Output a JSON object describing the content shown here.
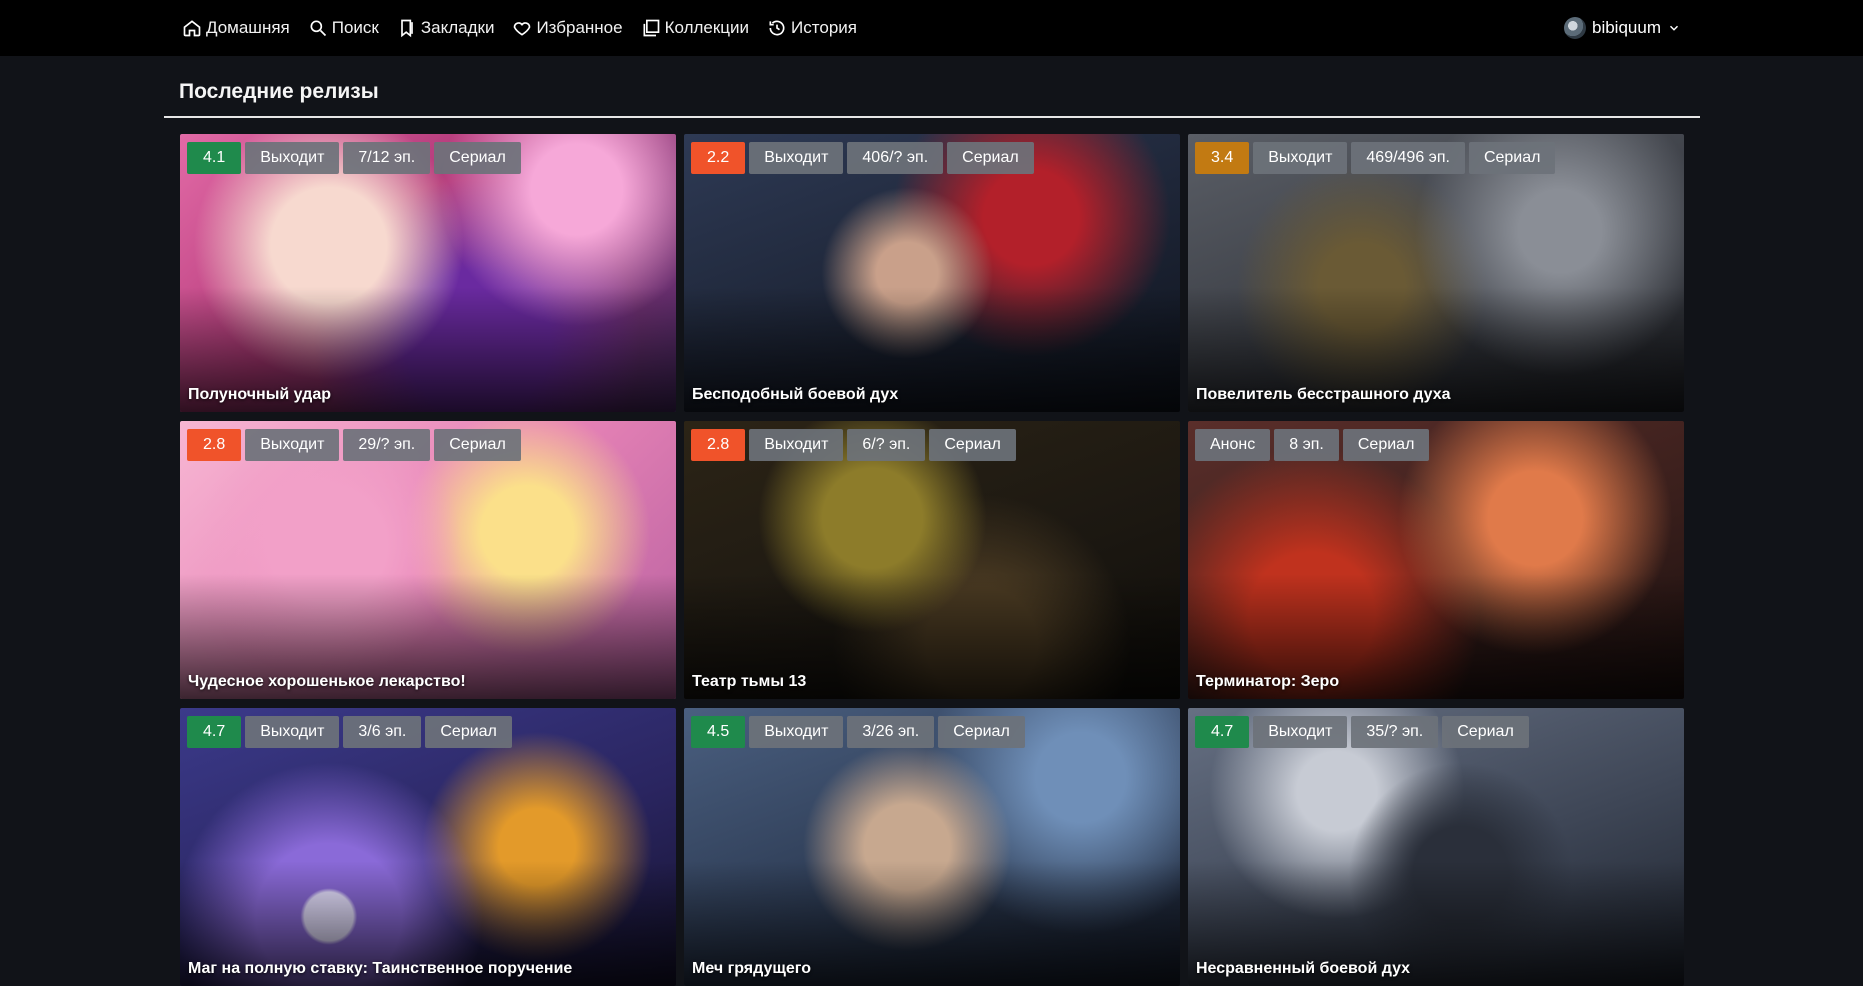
{
  "nav": {
    "items": [
      {
        "label": "Домашняя",
        "icon": "home-icon"
      },
      {
        "label": "Поиск",
        "icon": "search-icon"
      },
      {
        "label": "Закладки",
        "icon": "bookmark-icon"
      },
      {
        "label": "Избранное",
        "icon": "heart-icon"
      },
      {
        "label": "Коллекции",
        "icon": "collection-icon"
      },
      {
        "label": "История",
        "icon": "history-icon"
      }
    ],
    "username": "bibiquum"
  },
  "section": {
    "title": "Последние релизы"
  },
  "colors": {
    "rating_green": "#1f8a4c",
    "rating_orange": "#f0532a",
    "rating_amber": "#c27a12",
    "badge_gray": "#6c727a"
  },
  "cards": [
    {
      "title": "Полуночный удар",
      "rating": "4.1",
      "rating_color": "#1f8a4c",
      "badges": [
        "Выходит",
        "7/12 эп.",
        "Сериал"
      ]
    },
    {
      "title": "Бесподобный боевой дух",
      "rating": "2.2",
      "rating_color": "#f0532a",
      "badges": [
        "Выходит",
        "406/? эп.",
        "Сериал"
      ]
    },
    {
      "title": "Повелитель бесстрашного духа",
      "rating": "3.4",
      "rating_color": "#c27a12",
      "badges": [
        "Выходит",
        "469/496 эп.",
        "Сериал"
      ]
    },
    {
      "title": "Чудесное хорошенькое лекарство!",
      "rating": "2.8",
      "rating_color": "#f0532a",
      "badges": [
        "Выходит",
        "29/? эп.",
        "Сериал"
      ]
    },
    {
      "title": "Театр тьмы 13",
      "rating": "2.8",
      "rating_color": "#f0532a",
      "badges": [
        "Выходит",
        "6/? эп.",
        "Сериал"
      ]
    },
    {
      "title": "Терминатор: Зеро",
      "rating": "",
      "rating_color": "",
      "badges": [
        "Анонс",
        "8 эп.",
        "Сериал"
      ]
    },
    {
      "title": "Маг на полную ставку: Таинственное поручение",
      "rating": "4.7",
      "rating_color": "#1f8a4c",
      "badges": [
        "Выходит",
        "3/6 эп.",
        "Сериал"
      ]
    },
    {
      "title": "Меч грядущего",
      "rating": "4.5",
      "rating_color": "#1f8a4c",
      "badges": [
        "Выходит",
        "3/26 эп.",
        "Сериал"
      ]
    },
    {
      "title": "Несравненный боевой дух",
      "rating": "4.7",
      "rating_color": "#1f8a4c",
      "badges": [
        "Выходит",
        "35/? эп.",
        "Сериал"
      ]
    }
  ]
}
